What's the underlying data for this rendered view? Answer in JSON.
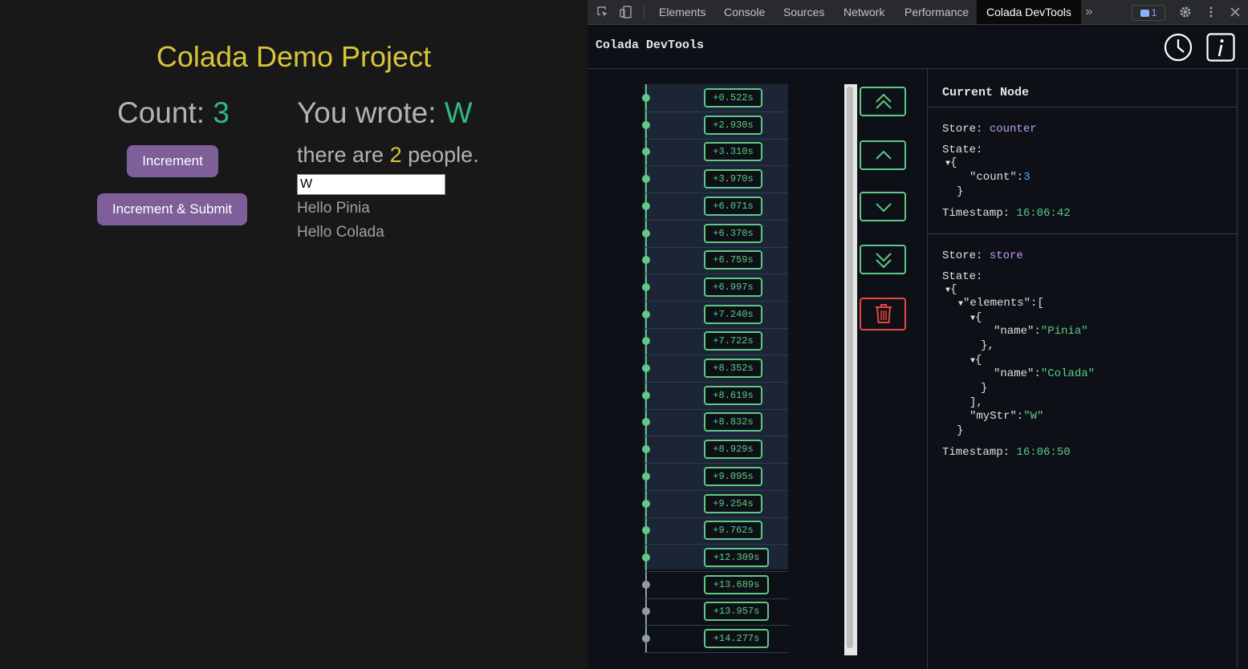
{
  "app": {
    "title": "Colada Demo Project",
    "count_label": "Count: ",
    "count_value": "3",
    "increment_label": "Increment",
    "increment_submit_label": "Increment & Submit",
    "wrote_label": "You wrote: ",
    "wrote_value": "W",
    "people_prefix": "there are ",
    "people_count": "2",
    "people_suffix": " people.",
    "input_value": "W",
    "names": [
      "Hello Pinia",
      "Hello Colada"
    ]
  },
  "devtools_tabs": [
    "Elements",
    "Console",
    "Sources",
    "Network",
    "Performance",
    "Colada DevTools"
  ],
  "active_tab": "Colada DevTools",
  "issues_count": "1",
  "devtools": {
    "title": "Colada DevTools",
    "timeline": [
      {
        "label": "+0.522s",
        "active": true
      },
      {
        "label": "+2.930s",
        "active": true
      },
      {
        "label": "+3.310s",
        "active": true
      },
      {
        "label": "+3.970s",
        "active": true
      },
      {
        "label": "+6.071s",
        "active": true
      },
      {
        "label": "+6.370s",
        "active": true
      },
      {
        "label": "+6.759s",
        "active": true
      },
      {
        "label": "+6.997s",
        "active": true
      },
      {
        "label": "+7.240s",
        "active": true
      },
      {
        "label": "+7.722s",
        "active": true
      },
      {
        "label": "+8.352s",
        "active": true
      },
      {
        "label": "+8.619s",
        "active": true
      },
      {
        "label": "+8.832s",
        "active": true
      },
      {
        "label": "+8.929s",
        "active": true
      },
      {
        "label": "+9.095s",
        "active": true
      },
      {
        "label": "+9.254s",
        "active": true
      },
      {
        "label": "+9.762s",
        "active": true
      },
      {
        "label": "+12.309s",
        "active": true
      },
      {
        "label": "+13.689s",
        "active": false
      },
      {
        "label": "+13.957s",
        "active": false
      },
      {
        "label": "+14.277s",
        "active": false
      }
    ],
    "panel": {
      "heading": "Current Node",
      "store_label": "Store: ",
      "state_label": "State:",
      "timestamp_label": "Timestamp: ",
      "store1_name": "counter",
      "store1_lines": [
        "{",
        "  \"count\":",
        "}"
      ],
      "store1_count": "3",
      "store1_timestamp": "16:06:42",
      "store2_name": "store",
      "store2_timestamp": "16:06:50",
      "store2_pinia": "\"Pinia\"",
      "store2_colada": "\"Colada\"",
      "store2_mystr": "\"W\""
    }
  },
  "colors": {
    "title_yellow": "#d9c53b",
    "value_green": "#2fb980",
    "button_purple": "#7f5f9a",
    "timeline_green": "#5fc884",
    "trash_red": "#e64545",
    "store_purple": "#c29bf0"
  }
}
